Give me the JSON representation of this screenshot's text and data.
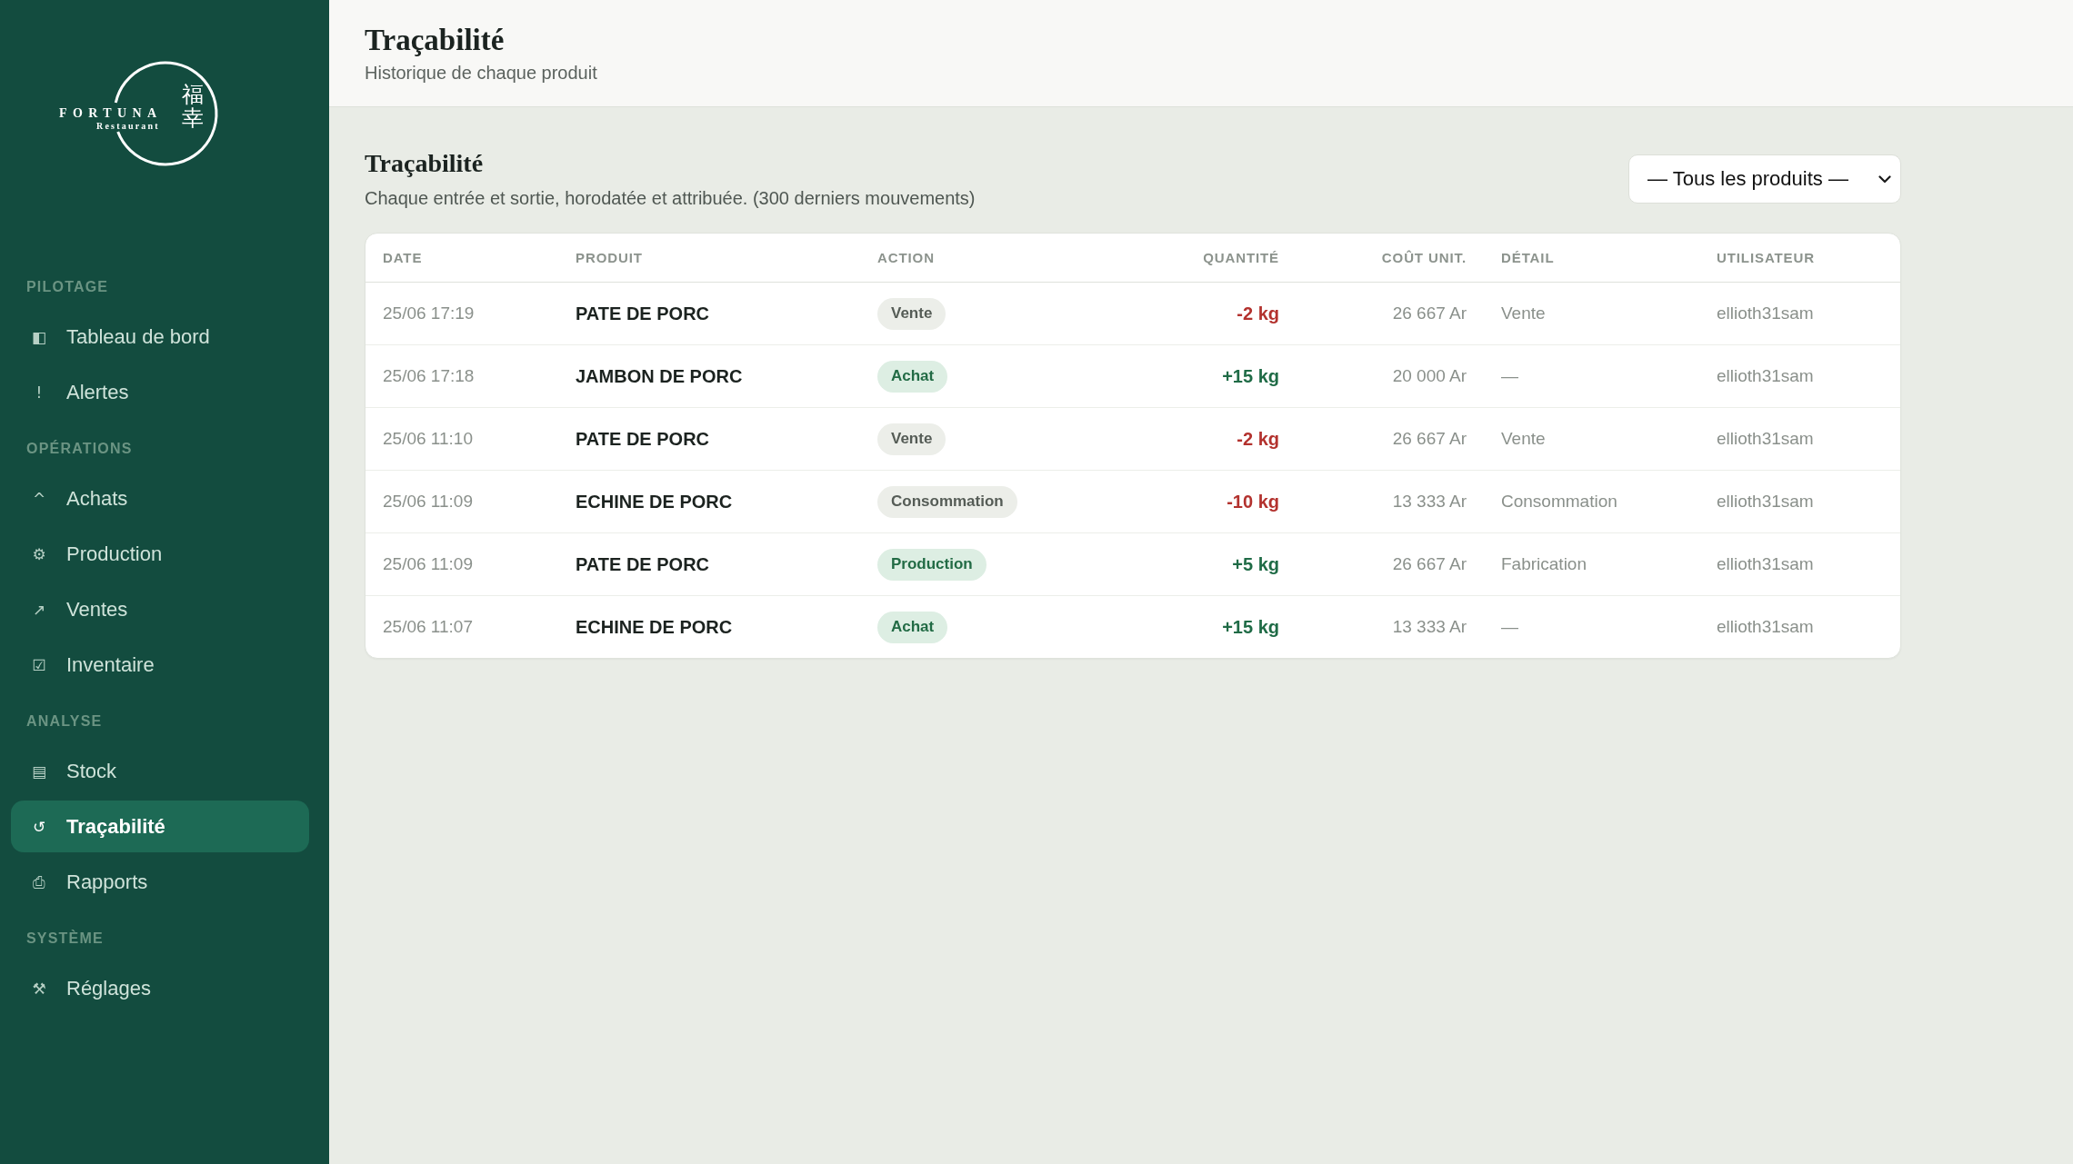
{
  "sidebar": {
    "logo": {
      "wordmark": "FORTUNA",
      "tagline": "Restaurant",
      "characters": "福幸"
    },
    "sections": [
      {
        "label": "PILOTAGE",
        "items": [
          {
            "icon": "◧",
            "label": "Tableau de bord",
            "selected": false
          },
          {
            "icon": "!",
            "label": "Alertes",
            "selected": false
          }
        ]
      },
      {
        "label": "OPÉRATIONS",
        "items": [
          {
            "icon": "^",
            "label": "Achats",
            "selected": false
          },
          {
            "icon": "⚙",
            "label": "Production",
            "selected": false
          },
          {
            "icon": "↗",
            "label": "Ventes",
            "selected": false
          },
          {
            "icon": "☑",
            "label": "Inventaire",
            "selected": false
          }
        ]
      },
      {
        "label": "ANALYSE",
        "items": [
          {
            "icon": "▤",
            "label": "Stock",
            "selected": false
          },
          {
            "icon": "↺",
            "label": "Traçabilité",
            "selected": true
          },
          {
            "icon": "⎙",
            "label": "Rapports",
            "selected": false
          }
        ]
      },
      {
        "label": "SYSTÈME",
        "items": [
          {
            "icon": "⚒",
            "label": "Réglages",
            "selected": false
          }
        ]
      }
    ]
  },
  "header": {
    "title": "Traçabilité",
    "subtitle": "Historique de chaque produit"
  },
  "section": {
    "title": "Traçabilité",
    "description": "Chaque entrée et sortie, horodatée et attribuée. (300 derniers mouvements)",
    "filter": {
      "value": "— Tous les produits —"
    }
  },
  "table": {
    "columns": [
      "DATE",
      "PRODUIT",
      "ACTION",
      "QUANTITÉ",
      "COÛT UNIT.",
      "DÉTAIL",
      "UTILISATEUR"
    ],
    "rows": [
      {
        "kind": "out",
        "date": "25/06 17:19",
        "product": "PATE DE PORC",
        "action": "Vente",
        "quantity": "-2 kg",
        "unit_cost": "26 667 Ar",
        "detail": "Vente",
        "user": "ellioth31sam"
      },
      {
        "kind": "in",
        "date": "25/06 17:18",
        "product": "JAMBON DE PORC",
        "action": "Achat",
        "quantity": "+15 kg",
        "unit_cost": "20 000 Ar",
        "detail": "—",
        "user": "ellioth31sam"
      },
      {
        "kind": "out",
        "date": "25/06 11:10",
        "product": "PATE DE PORC",
        "action": "Vente",
        "quantity": "-2 kg",
        "unit_cost": "26 667 Ar",
        "detail": "Vente",
        "user": "ellioth31sam"
      },
      {
        "kind": "out",
        "date": "25/06 11:09",
        "product": "ECHINE DE PORC",
        "action": "Consommation",
        "quantity": "-10 kg",
        "unit_cost": "13 333 Ar",
        "detail": "Consommation",
        "user": "ellioth31sam"
      },
      {
        "kind": "in",
        "date": "25/06 11:09",
        "product": "PATE DE PORC",
        "action": "Production",
        "quantity": "+5 kg",
        "unit_cost": "26 667 Ar",
        "detail": "Fabrication",
        "user": "ellioth31sam"
      },
      {
        "kind": "in",
        "date": "25/06 11:07",
        "product": "ECHINE DE PORC",
        "action": "Achat",
        "quantity": "+15 kg",
        "unit_cost": "13 333 Ar",
        "detail": "—",
        "user": "ellioth31sam"
      }
    ]
  }
}
